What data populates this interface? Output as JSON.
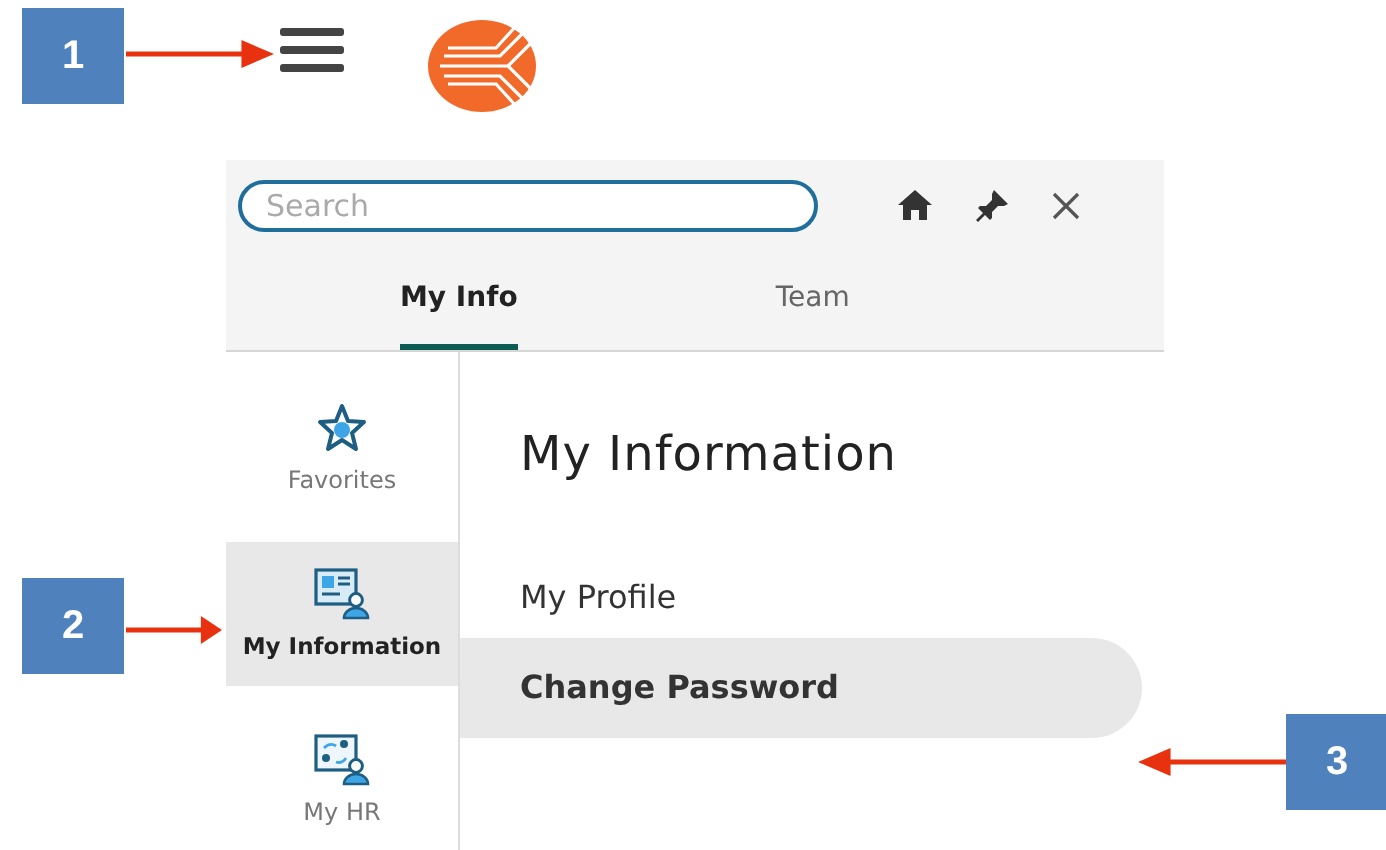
{
  "search": {
    "placeholder": "Search"
  },
  "tabs": [
    {
      "label": "My Info",
      "selected": true
    },
    {
      "label": "Team",
      "selected": false
    }
  ],
  "sidebar": {
    "items": [
      {
        "label": "Favorites",
        "kind": "star",
        "selected": false
      },
      {
        "label": "My Information",
        "kind": "card",
        "selected": true
      },
      {
        "label": "My HR",
        "kind": "board",
        "selected": false
      }
    ]
  },
  "content": {
    "heading": "My Information",
    "links": [
      {
        "label": "My Profile",
        "selected": false
      },
      {
        "label": "Change Password",
        "selected": true
      }
    ]
  },
  "callouts": [
    {
      "label": "1",
      "kind": "right"
    },
    {
      "label": "2",
      "kind": "right"
    },
    {
      "label": "3",
      "kind": "left"
    }
  ]
}
